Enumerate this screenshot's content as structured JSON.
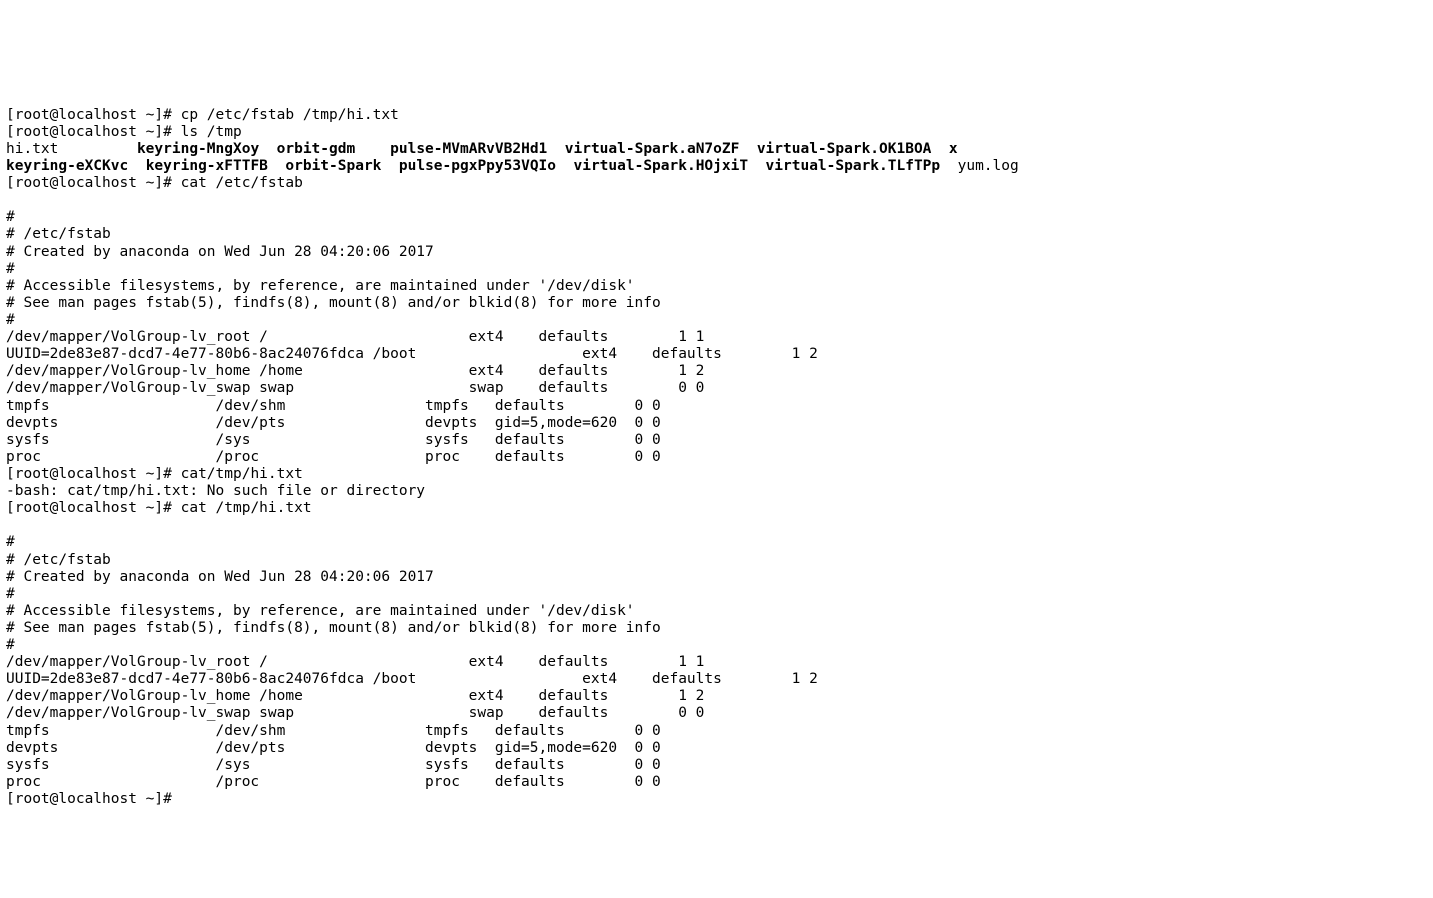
{
  "prompt": "[root@localhost ~]# ",
  "commands": {
    "cp": "cp /etc/fstab /tmp/hi.txt",
    "ls": "ls /tmp",
    "cat_fstab": "cat /etc/fstab",
    "cat_bad": "cat/tmp/hi.txt",
    "cat_hi": "cat /tmp/hi.txt"
  },
  "ls_output": {
    "row1": {
      "c1": "hi.txt         ",
      "c2": "keyring-MngXoy  ",
      "c3": "orbit-gdm    ",
      "c4": "pulse-MVmARvVB2Hd1  ",
      "c5": "virtual-Spark.aN7oZF  ",
      "c6": "virtual-Spark.OK1BOA  ",
      "c7": "x"
    },
    "row2": {
      "c1": "keyring-eXCKvc  ",
      "c2": "keyring-xFTTFB  ",
      "c3": "orbit-Spark  ",
      "c4": "pulse-pgxPpy53VQIo  ",
      "c5": "virtual-Spark.HOjxiT  ",
      "c6": "virtual-Spark.TLfTPp",
      "c7": "  yum.log"
    }
  },
  "error_line": "-bash: cat/tmp/hi.txt: No such file or directory",
  "fstab": {
    "l0": "",
    "l1": "#",
    "l2": "# /etc/fstab",
    "l3": "# Created by anaconda on Wed Jun 28 04:20:06 2017",
    "l4": "#",
    "l5": "# Accessible filesystems, by reference, are maintained under '/dev/disk'",
    "l6": "# See man pages fstab(5), findfs(8), mount(8) and/or blkid(8) for more info",
    "l7": "#",
    "l8": "/dev/mapper/VolGroup-lv_root /                       ext4    defaults        1 1",
    "l9": "UUID=2de83e87-dcd7-4e77-80b6-8ac24076fdca /boot                   ext4    defaults        1 2",
    "l10": "/dev/mapper/VolGroup-lv_home /home                   ext4    defaults        1 2",
    "l11": "/dev/mapper/VolGroup-lv_swap swap                    swap    defaults        0 0",
    "l12": "tmpfs                   /dev/shm                tmpfs   defaults        0 0",
    "l13": "devpts                  /dev/pts                devpts  gid=5,mode=620  0 0",
    "l14": "sysfs                   /sys                    sysfs   defaults        0 0",
    "l15": "proc                    /proc                   proc    defaults        0 0"
  }
}
